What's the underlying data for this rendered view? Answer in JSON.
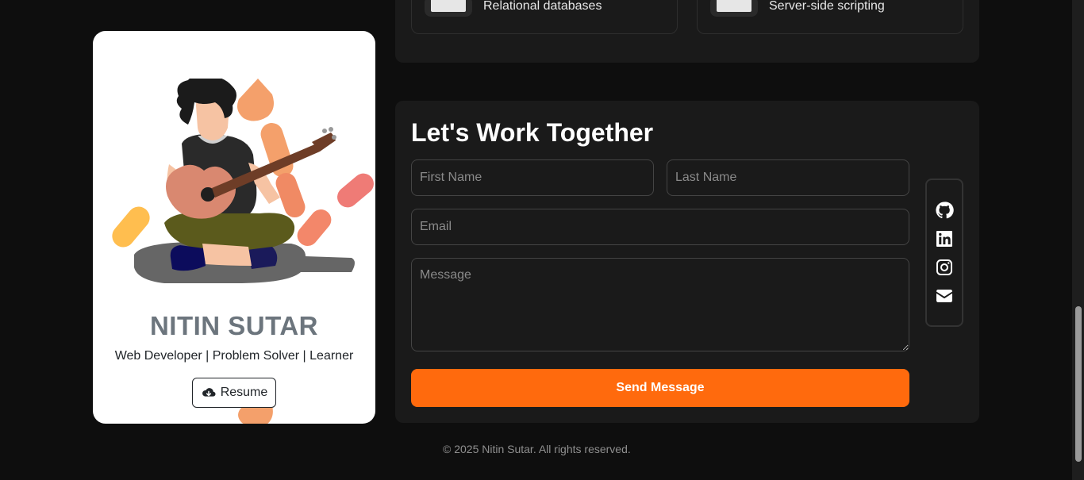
{
  "profile": {
    "name": "NITIN SUTAR",
    "tagline": "Web Developer | Problem Solver | Learner",
    "resume_label": "Resume"
  },
  "skills": [
    {
      "label": "Relational databases"
    },
    {
      "label": "Server-side scripting"
    }
  ],
  "contact": {
    "title": "Let's Work Together",
    "first_name_placeholder": "First Name",
    "last_name_placeholder": "Last Name",
    "email_placeholder": "Email",
    "message_placeholder": "Message",
    "send_label": "Send Message"
  },
  "social": [
    "github-icon",
    "linkedin-icon",
    "instagram-icon",
    "envelope-icon"
  ],
  "footer": {
    "copyright": "© 2025 Nitin Sutar. All rights reserved."
  },
  "colors": {
    "accent": "#ff6a0d",
    "background": "#0e0e0e",
    "panel": "#1a1a1a",
    "card": "#ffffff",
    "name_text": "#6c757d"
  }
}
